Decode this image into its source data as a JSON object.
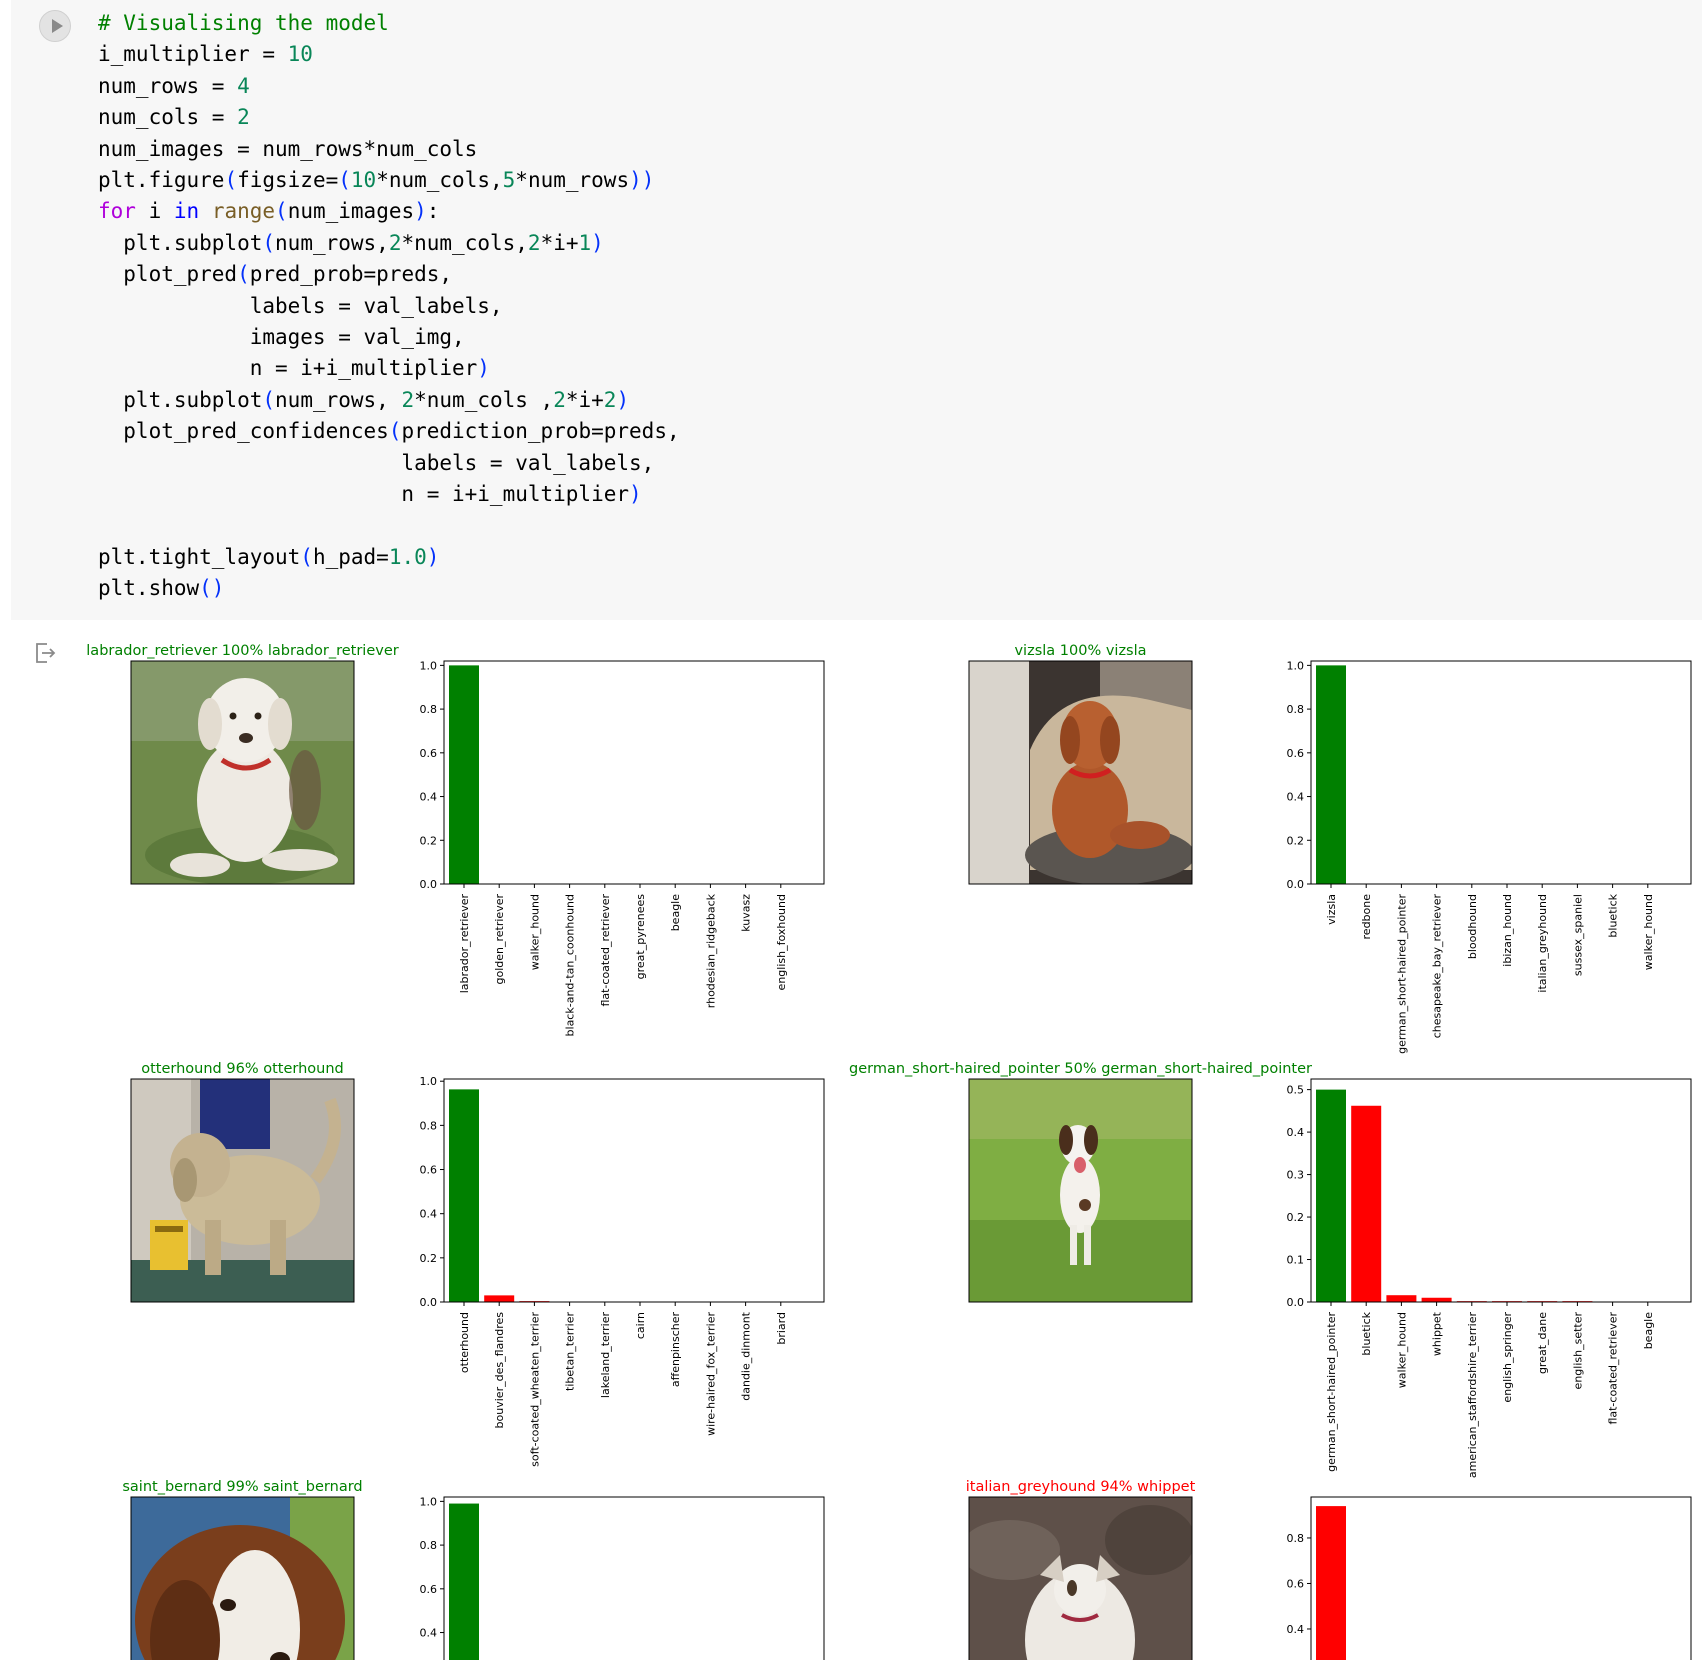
{
  "code_cell": {
    "lines": [
      [
        [
          "c",
          "# Visualising the model"
        ]
      ],
      [
        [
          "t",
          "i_multiplier = "
        ],
        [
          "n",
          "10"
        ]
      ],
      [
        [
          "t",
          "num_rows = "
        ],
        [
          "n",
          "4"
        ]
      ],
      [
        [
          "t",
          "num_cols = "
        ],
        [
          "n",
          "2"
        ]
      ],
      [
        [
          "t",
          "num_images = num_rows*num_cols"
        ]
      ],
      [
        [
          "t",
          "plt.figure"
        ],
        [
          "p",
          "("
        ],
        [
          "t",
          "figsize="
        ],
        [
          "p",
          "("
        ],
        [
          "n",
          "10"
        ],
        [
          "t",
          "*num_cols,"
        ],
        [
          "n",
          "5"
        ],
        [
          "t",
          "*num_rows"
        ],
        [
          "p",
          "))"
        ]
      ],
      [
        [
          "k",
          "for"
        ],
        [
          "t",
          " i "
        ],
        [
          "kb",
          "in"
        ],
        [
          "t",
          " "
        ],
        [
          "f",
          "range"
        ],
        [
          "p",
          "("
        ],
        [
          "t",
          "num_images"
        ],
        [
          "p",
          ")"
        ],
        [
          "t",
          ":"
        ]
      ],
      [
        [
          "t",
          "  plt.subplot"
        ],
        [
          "p",
          "("
        ],
        [
          "t",
          "num_rows,"
        ],
        [
          "n",
          "2"
        ],
        [
          "t",
          "*num_cols,"
        ],
        [
          "n",
          "2"
        ],
        [
          "t",
          "*i+"
        ],
        [
          "n",
          "1"
        ],
        [
          "p",
          ")"
        ]
      ],
      [
        [
          "t",
          "  plot_pred"
        ],
        [
          "p",
          "("
        ],
        [
          "t",
          "pred_prob=preds,"
        ]
      ],
      [
        [
          "t",
          "            labels = val_labels,"
        ]
      ],
      [
        [
          "t",
          "            images = val_img,"
        ]
      ],
      [
        [
          "t",
          "            n = i+i_multiplier"
        ],
        [
          "p",
          ")"
        ]
      ],
      [
        [
          "t",
          "  plt.subplot"
        ],
        [
          "p",
          "("
        ],
        [
          "t",
          "num_rows, "
        ],
        [
          "n",
          "2"
        ],
        [
          "t",
          "*num_cols ,"
        ],
        [
          "n",
          "2"
        ],
        [
          "t",
          "*i+"
        ],
        [
          "n",
          "2"
        ],
        [
          "p",
          ")"
        ]
      ],
      [
        [
          "t",
          "  plot_pred_confidences"
        ],
        [
          "p",
          "("
        ],
        [
          "t",
          "prediction_prob=preds,"
        ]
      ],
      [
        [
          "t",
          "                        labels = val_labels,"
        ]
      ],
      [
        [
          "t",
          "                        n = i+i_multiplier"
        ],
        [
          "p",
          ")"
        ]
      ],
      [
        [
          "t",
          ""
        ]
      ],
      [
        [
          "t",
          "plt.tight_layout"
        ],
        [
          "p",
          "("
        ],
        [
          "t",
          "h_pad="
        ],
        [
          "n",
          "1.0"
        ],
        [
          "p",
          ")"
        ]
      ],
      [
        [
          "t",
          "plt.show"
        ],
        [
          "p",
          "()"
        ]
      ]
    ]
  },
  "colors": {
    "correct": "#008000",
    "wrong": "#ff0000",
    "axis": "#000000"
  },
  "icons": {
    "run": "play-circle-icon",
    "output": "output-arrow-icon"
  },
  "chart_data": [
    {
      "type": "image",
      "title": "labrador_retriever 100% labrador_retriever",
      "title_color": "#008000",
      "scene": "labrador"
    },
    {
      "type": "bar",
      "categories": [
        "labrador_retriever",
        "golden_retriever",
        "walker_hound",
        "black-and-tan_coonhound",
        "flat-coated_retriever",
        "great_pyrenees",
        "beagle",
        "rhodesian_ridgeback",
        "kuvasz",
        "english_foxhound"
      ],
      "values": [
        1.0,
        0.0,
        0.0,
        0.0,
        0.0,
        0.0,
        0.0,
        0.0,
        0.0,
        0.0
      ],
      "colors": [
        "#008000",
        "#808080",
        "#808080",
        "#808080",
        "#808080",
        "#808080",
        "#808080",
        "#808080",
        "#808080",
        "#808080"
      ],
      "ylim": [
        0,
        1.02
      ],
      "yticks": [
        "0.0",
        "0.2",
        "0.4",
        "0.6",
        "0.8",
        "1.0"
      ],
      "grid": false,
      "title": "",
      "xlabel": "",
      "ylabel": ""
    },
    {
      "type": "image",
      "title": "vizsla 100% vizsla",
      "title_color": "#008000",
      "scene": "vizsla"
    },
    {
      "type": "bar",
      "categories": [
        "vizsla",
        "redbone",
        "german_short-haired_pointer",
        "chesapeake_bay_retriever",
        "bloodhound",
        "ibizan_hound",
        "italian_greyhound",
        "sussex_spaniel",
        "bluetick",
        "walker_hound"
      ],
      "values": [
        1.0,
        0.0,
        0.0,
        0.0,
        0.0,
        0.0,
        0.0,
        0.0,
        0.0,
        0.0
      ],
      "colors": [
        "#008000",
        "#808080",
        "#808080",
        "#808080",
        "#808080",
        "#808080",
        "#808080",
        "#808080",
        "#808080",
        "#808080"
      ],
      "ylim": [
        0,
        1.02
      ],
      "yticks": [
        "0.0",
        "0.2",
        "0.4",
        "0.6",
        "0.8",
        "1.0"
      ],
      "grid": false,
      "title": "",
      "xlabel": "",
      "ylabel": ""
    },
    {
      "type": "image",
      "title": "otterhound 96% otterhound",
      "title_color": "#008000",
      "scene": "otterhound"
    },
    {
      "type": "bar",
      "categories": [
        "otterhound",
        "bouvier_des_flandres",
        "soft-coated_wheaten_terrier",
        "tibetan_terrier",
        "lakeland_terrier",
        "cairn",
        "affenpinscher",
        "wire-haired_fox_terrier",
        "dandie_dinmont",
        "briard"
      ],
      "values": [
        0.963,
        0.03,
        0.004,
        0.001,
        0.0005,
        0.0003,
        0.0002,
        0.0001,
        0.0001,
        0.0001
      ],
      "colors": [
        "#008000",
        "#ff0000",
        "#ff0000",
        "#ff0000",
        "#ff0000",
        "#ff0000",
        "#ff0000",
        "#ff0000",
        "#ff0000",
        "#ff0000"
      ],
      "ylim": [
        0,
        1.01
      ],
      "yticks": [
        "0.0",
        "0.2",
        "0.4",
        "0.6",
        "0.8",
        "1.0"
      ],
      "grid": false,
      "title": "",
      "xlabel": "",
      "ylabel": ""
    },
    {
      "type": "image",
      "title": "german_short-haired_pointer 50% german_short-haired_pointer",
      "title_color": "#008000",
      "scene": "pointer"
    },
    {
      "type": "bar",
      "categories": [
        "german_short-haired_pointer",
        "bluetick",
        "walker_hound",
        "whippet",
        "american_staffordshire_terrier",
        "english_springer",
        "great_dane",
        "english_setter",
        "flat-coated_retriever",
        "beagle"
      ],
      "values": [
        0.5,
        0.462,
        0.016,
        0.01,
        0.002,
        0.002,
        0.002,
        0.002,
        0.001,
        0.001
      ],
      "colors": [
        "#008000",
        "#ff0000",
        "#ff0000",
        "#ff0000",
        "#ff0000",
        "#ff0000",
        "#ff0000",
        "#ff0000",
        "#ff0000",
        "#ff0000"
      ],
      "ylim": [
        0,
        0.525
      ],
      "yticks": [
        "0.0",
        "0.1",
        "0.2",
        "0.3",
        "0.4",
        "0.5"
      ],
      "grid": false,
      "title": "",
      "xlabel": "",
      "ylabel": ""
    },
    {
      "type": "image",
      "title": "saint_bernard 99% saint_bernard",
      "title_color": "#008000",
      "scene": "saint_bernard"
    },
    {
      "type": "bar",
      "categories": [],
      "values": [
        0.99
      ],
      "colors": [
        "#008000"
      ],
      "ylim": [
        0,
        1.02
      ],
      "yticks": [
        "0.4",
        "0.6",
        "0.8",
        "1.0"
      ],
      "grid": false,
      "title": "",
      "xlabel": "",
      "ylabel": ""
    },
    {
      "type": "image",
      "title": "italian_greyhound 94% whippet",
      "title_color": "#ff0000",
      "scene": "whippet"
    },
    {
      "type": "bar",
      "categories": [],
      "values": [
        0.94
      ],
      "colors": [
        "#ff0000"
      ],
      "ylim": [
        0,
        0.98
      ],
      "yticks": [
        "0.4",
        "0.6",
        "0.8"
      ],
      "grid": false,
      "title": "",
      "xlabel": "",
      "ylabel": ""
    }
  ]
}
